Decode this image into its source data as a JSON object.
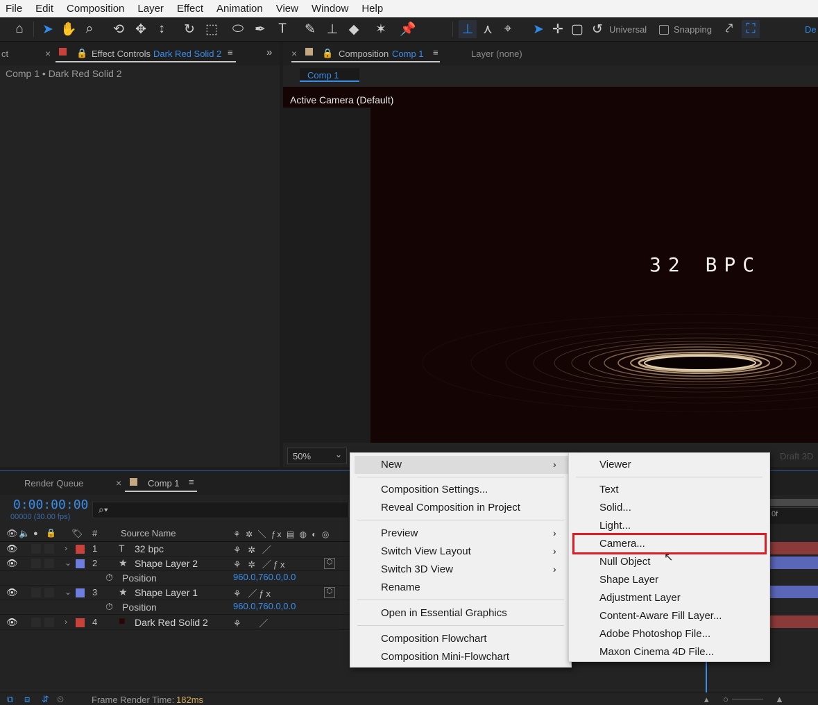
{
  "menubar": [
    "File",
    "Edit",
    "Composition",
    "Layer",
    "Effect",
    "Animation",
    "View",
    "Window",
    "Help"
  ],
  "toolbar": {
    "universal": "Universal",
    "snapping": "Snapping",
    "workspace_partial": "De"
  },
  "effect_panel": {
    "left_tab_partial": "ct",
    "tab_label": "Effect Controls",
    "tab_target": "Dark Red Solid 2",
    "breadcrumb": "Comp 1 • Dark Red Solid 2"
  },
  "comp_panel": {
    "tab_label": "Composition",
    "tab_target": "Comp 1",
    "layer_tab": "Layer (none)",
    "comp_chip": "Comp 1",
    "camera_label": "Active Camera (Default)",
    "overlay_text": "32 BPC",
    "zoom": "50%",
    "draft3d": "Draft 3D"
  },
  "timeline": {
    "render_queue": "Render Queue",
    "tab_label": "Comp 1",
    "timecode": "0:00:00:00",
    "fps": "00000 (30.00 fps)",
    "hash_header": "#",
    "source_name_header": "Source Name",
    "ruler_label": "0f",
    "layers": [
      {
        "num": "1",
        "type_icon": "T",
        "name": "32 bpc",
        "color": "#c8413a"
      },
      {
        "num": "2",
        "type_icon": "★",
        "name": "Shape Layer 2",
        "color": "#6e7ee0",
        "prop": "Position",
        "value": "960.0,760.0,0.0"
      },
      {
        "num": "3",
        "type_icon": "★",
        "name": "Shape Layer 1",
        "color": "#6e7ee0",
        "prop": "Position",
        "value": "960.0,760.0,0.0"
      },
      {
        "num": "4",
        "type_icon": "■",
        "name": "Dark Red Solid 2",
        "color": "#c8413a"
      }
    ]
  },
  "status": {
    "frame_render_label": "Frame Render Time:",
    "frame_render_value": "182ms"
  },
  "context_menu": {
    "new": "New",
    "composition_settings": "Composition Settings...",
    "reveal": "Reveal Composition in Project",
    "preview": "Preview",
    "switch_view_layout": "Switch View Layout",
    "switch_3d_view": "Switch 3D View",
    "rename": "Rename",
    "open_essential": "Open in Essential Graphics",
    "flowchart": "Composition Flowchart",
    "mini_flowchart": "Composition Mini-Flowchart"
  },
  "submenu": {
    "viewer": "Viewer",
    "text": "Text",
    "solid": "Solid...",
    "light": "Light...",
    "camera": "Camera...",
    "null_object": "Null Object",
    "shape_layer": "Shape Layer",
    "adjustment_layer": "Adjustment Layer",
    "content_aware": "Content-Aware Fill Layer...",
    "photoshop": "Adobe Photoshop File...",
    "cinema4d": "Maxon Cinema 4D File..."
  },
  "colors": {
    "accent_blue": "#3a8eea",
    "highlight_red": "#e01b24",
    "label_red": "#c8413a",
    "label_blue": "#6e7ee0"
  }
}
